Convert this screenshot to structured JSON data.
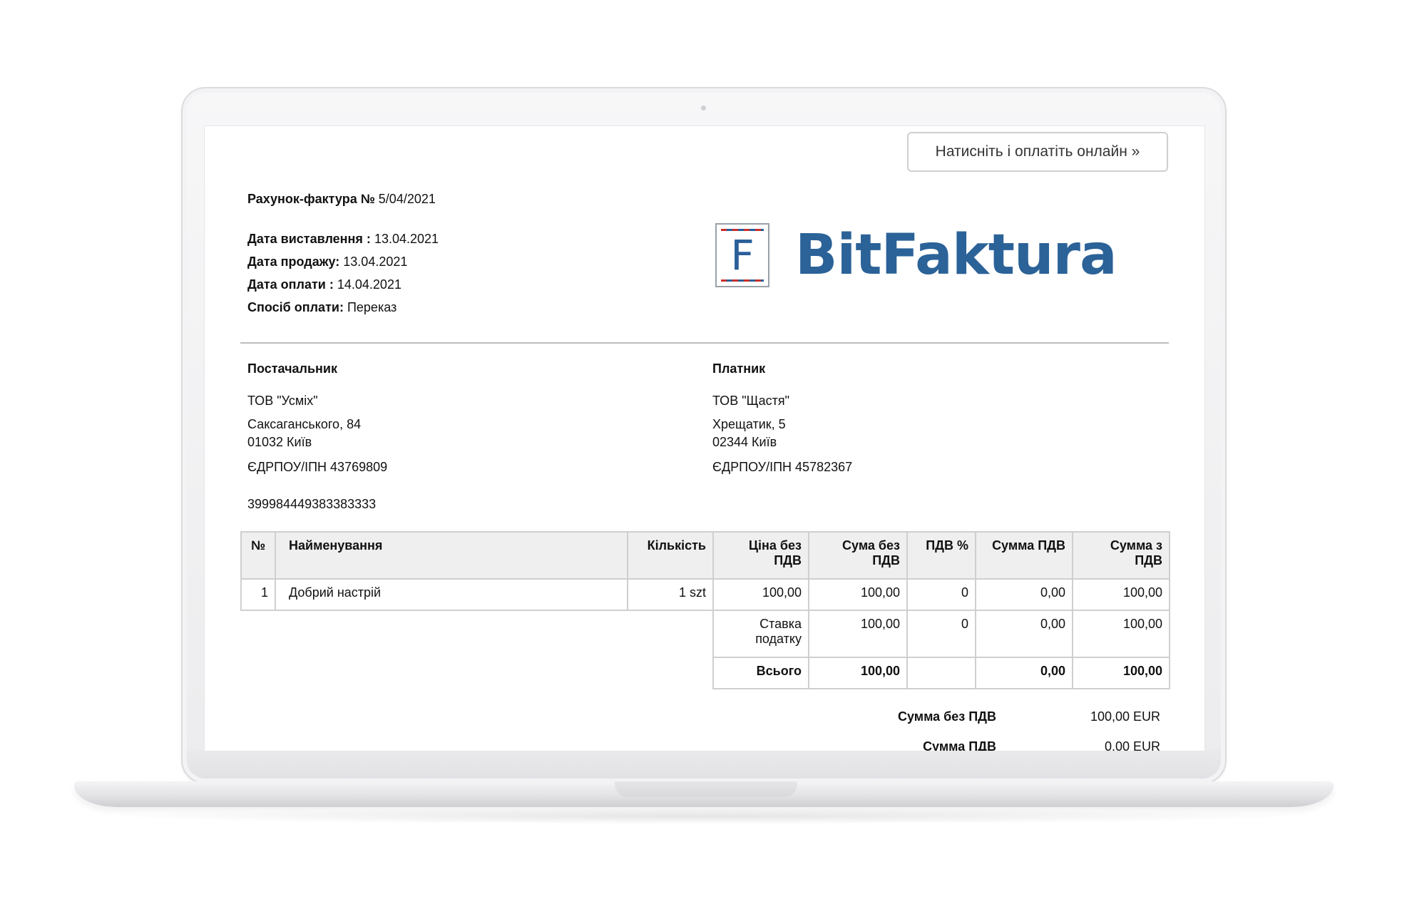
{
  "pay_button": {
    "label": "Натисніть і оплатіть онлайн »"
  },
  "invoice": {
    "title_label": "Рахунок-фактура №",
    "number": "5/04/2021",
    "issue_date_label": "Дата виставлення :",
    "issue_date": "13.04.2021",
    "sale_date_label": "Дата продажу:",
    "sale_date": "13.04.2021",
    "payment_date_label": "Дата оплати :",
    "payment_date": "14.04.2021",
    "payment_method_label": "Спосіб оплати:",
    "payment_method": "Переказ"
  },
  "logo": {
    "letter": "F",
    "text": "BitFaktura",
    "color": "#2b6298"
  },
  "supplier": {
    "heading": "Постачальник",
    "name": "ТОВ \"Усміх\"",
    "street": "Саксаганського, 84",
    "city": "01032 Київ",
    "tax_id": "ЄДРПОУ/ІПН 43769809",
    "account": "399984449383383333"
  },
  "payer": {
    "heading": "Платник",
    "name": "ТОВ \"Щастя\"",
    "street": "Хрещатик, 5",
    "city": "02344 Київ",
    "tax_id": "ЄДРПОУ/ІПН 45782367"
  },
  "table": {
    "headers": {
      "no": "№",
      "name": "Найменування",
      "qty": "Кількість",
      "price_net": "Ціна без ПДВ",
      "sum_net": "Сума без ПДВ",
      "vat_pct": "ПДВ %",
      "vat_sum": "Сумма ПДВ",
      "sum_gross": "Сумма з ПДВ"
    },
    "rows": [
      {
        "no": "1",
        "name": "Добрий настрій",
        "qty": "1 szt",
        "price_net": "100,00",
        "sum_net": "100,00",
        "vat_pct": "0",
        "vat_sum": "0,00",
        "sum_gross": "100,00"
      }
    ],
    "tax_rate_row": {
      "label": "Ставка податку",
      "sum_net": "100,00",
      "vat_pct": "0",
      "vat_sum": "0,00",
      "sum_gross": "100,00"
    },
    "total_row": {
      "label": "Всього",
      "sum_net": "100,00",
      "vat_pct": "",
      "vat_sum": "0,00",
      "sum_gross": "100,00"
    }
  },
  "summary": {
    "net_label": "Сумма без ПДВ",
    "net_value": "100,00 EUR",
    "vat_label": "Сумма ПДВ",
    "vat_value": "0,00 EUR"
  }
}
